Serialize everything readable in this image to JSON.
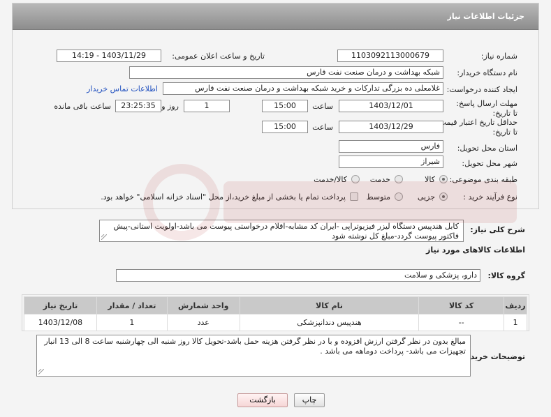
{
  "header": {
    "title": "جزئیات اطلاعات نیاز"
  },
  "form": {
    "need_number": {
      "label": "شماره نیاز:",
      "value": "1103092113000679"
    },
    "announce_datetime": {
      "label": "تاریخ و ساعت اعلان عمومی:",
      "value": "1403/11/29 - 14:19"
    },
    "buyer_org": {
      "label": "نام دستگاه خریدار:",
      "value": "شبکه بهداشت و درمان صنعت نفت فارس"
    },
    "requester": {
      "label": "ایجاد کننده درخواست:",
      "value": "غلامعلی ده بزرگی تدارکات و خرید شبکه بهداشت و درمان صنعت نفت فارس",
      "contact_link": "اطلاعات تماس خریدار"
    },
    "reply_deadline": {
      "label": "مهلت ارسال پاسخ: تا تاریخ:",
      "date": "1403/12/01",
      "time_label": "ساعت",
      "time": "15:00",
      "days": "1",
      "days_label": "روز و",
      "remaining": "23:25:35",
      "remaining_label": "ساعت باقی مانده"
    },
    "price_validity": {
      "label": "حداقل تاریخ اعتبار قیمت: تا تاریخ:",
      "date": "1403/12/29",
      "time_label": "ساعت",
      "time": "15:00"
    },
    "province": {
      "label": "استان محل تحویل:",
      "value": "فارس"
    },
    "city": {
      "label": "شهر محل تحویل:",
      "value": "شیراز"
    },
    "category": {
      "label": "طبقه بندی موضوعی:",
      "options": [
        "کالا",
        "خدمت",
        "کالا/خدمت"
      ]
    },
    "process_type": {
      "label": "نوع فرآیند خرید :",
      "options": [
        "جزیی",
        "متوسط"
      ],
      "payment_note": "پرداخت تمام یا بخشی از مبلغ خرید،از محل \"اسناد خزانه اسلامی\" خواهد بود."
    }
  },
  "summary": {
    "label": "شرح کلی نیاز:",
    "text": "کابل هندپیس دستگاه لیزر فیزیوتراپی -ایران کد مشابه-اقلام درخواستی پیوست می باشد-اولویت استانی-پیش فاکتور پیوست گردد-مبلغ کل نوشته شود"
  },
  "goods_info": {
    "title": "اطلاعات کالاهای مورد نیاز",
    "group_label": "گروه کالا:",
    "group_value": "دارو، پزشکی و سلامت",
    "table": {
      "headers": [
        "ردیف",
        "کد کالا",
        "نام کالا",
        "واحد شمارش",
        "تعداد / مقدار",
        "تاریخ نیاز"
      ],
      "rows": [
        [
          "1",
          "--",
          "هندپیس دندانپزشکی",
          "عدد",
          "1",
          "1403/12/08"
        ]
      ]
    }
  },
  "buyer_notes": {
    "label": "توضیحات خریدار:",
    "text": "مبالغ بدون در نظر گرفتن ارزش افزوده و با در نظر گرفتن هزینه حمل باشد-تحویل کالا روز شنبه الی چهارشنبه ساعت 8 الی 13 انبار تجهیزات می باشد- پرداخت دوماهه می باشد ."
  },
  "buttons": {
    "print": "چاپ",
    "back": "بازگشت"
  },
  "colors": {
    "header_bar": "#9e9e9e",
    "link": "#1f4fbf",
    "back_button": "#f6d6d6",
    "table_header": "#c9c9c9"
  }
}
